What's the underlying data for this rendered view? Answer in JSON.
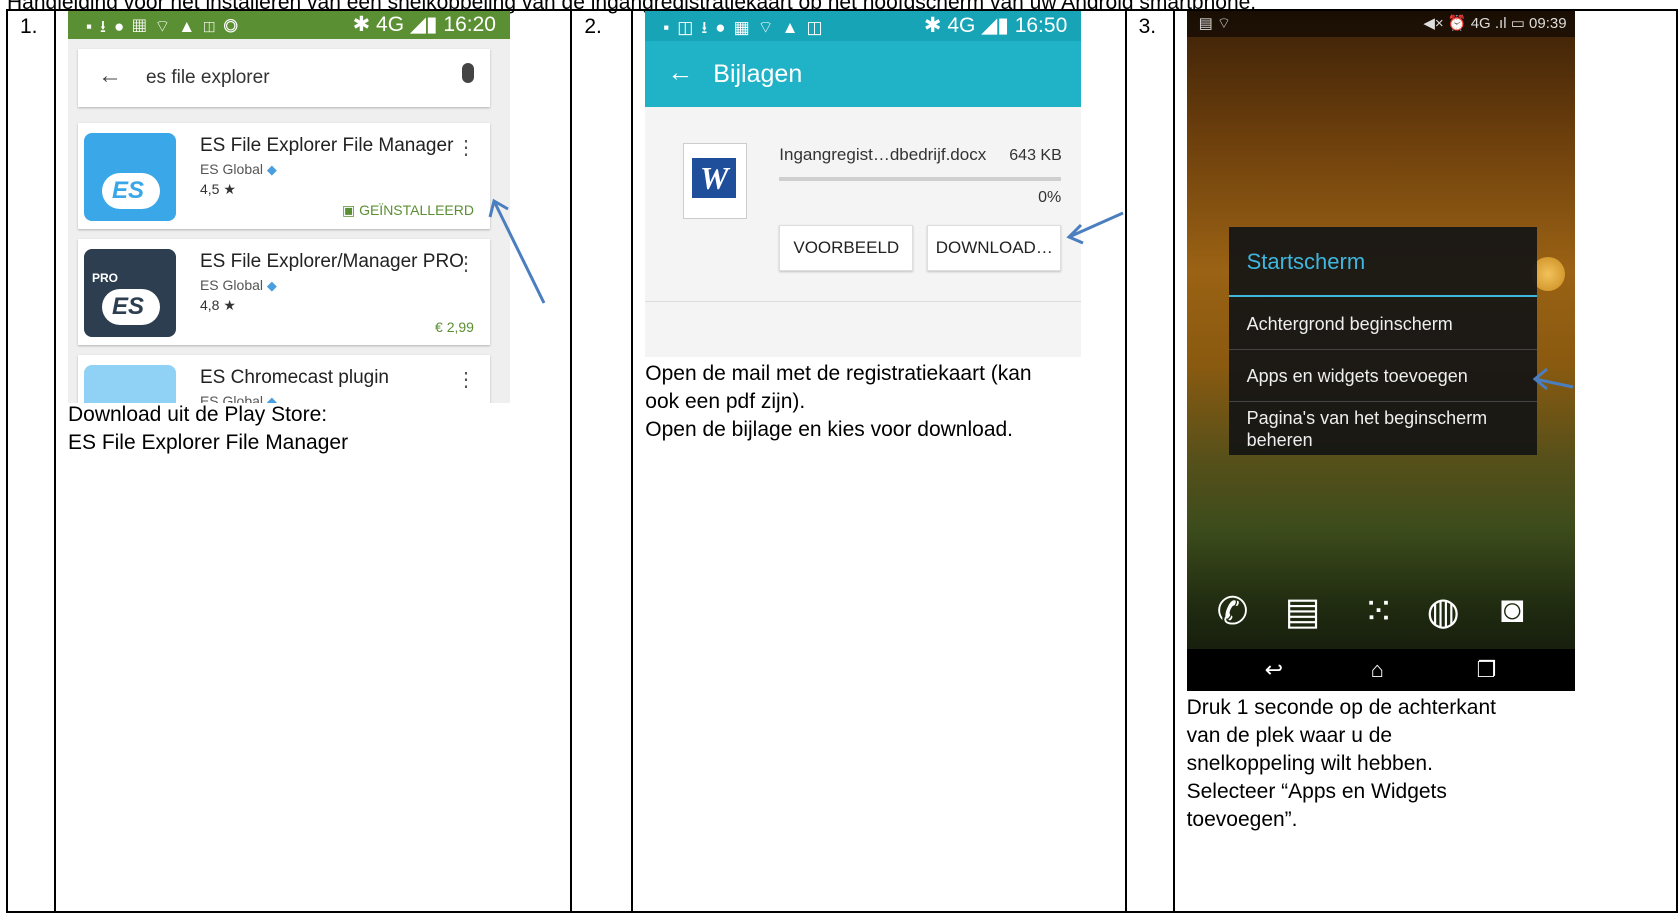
{
  "document": {
    "title": "Handleiding voor het installeren van een snelkoppeling van de ingangregistratiekaart op het hoofdscherm van uw Android smartphone:"
  },
  "steps": [
    {
      "number": "1.",
      "screenshot": {
        "status_time": "16:20",
        "network": "4G",
        "search_query": "es file explorer",
        "apps": [
          {
            "name": "ES File Explorer File Manager",
            "developer": "ES Global",
            "rating": "4,5",
            "status": "GEÏNSTALLEERD"
          },
          {
            "name": "ES File Explorer/Manager PRO",
            "developer": "ES Global",
            "rating": "4,8",
            "status": "€ 2,99",
            "badge": "PRO"
          },
          {
            "name": "ES Chromecast plugin",
            "developer": "ES Global"
          }
        ]
      },
      "caption_line1": "Download uit de Play Store:",
      "caption_line2": "ES File Explorer File Manager"
    },
    {
      "number": "2.",
      "screenshot": {
        "status_time": "16:50",
        "network": "4G",
        "title": "Bijlagen",
        "file_name": "Ingangregist…dbedrijf.docx",
        "file_size": "643 KB",
        "progress_percent": "0%",
        "progress_value": 0,
        "btn_preview": "VOORBEELD",
        "btn_download": "DOWNLOAD…"
      },
      "caption_line1": "Open de mail met de registratiekaart (kan",
      "caption_line2": "ook een pdf zijn).",
      "caption_line3": "Open de bijlage en kies voor download."
    },
    {
      "number": "3.",
      "screenshot": {
        "status_time": "09:39",
        "network": "4G",
        "menu_title": "Startscherm",
        "menu_items": [
          "Achtergrond beginscherm",
          "Apps en widgets toevoegen",
          "Pagina's van het beginscherm beheren"
        ]
      },
      "caption_line1": "Druk 1 seconde op de achterkant",
      "caption_line2": "van de plek waar u de",
      "caption_line3": "snelkoppeling wilt hebben.",
      "caption_line4": "Selecteer “Apps en Widgets",
      "caption_line5": "toevoegen”."
    }
  ],
  "colors": {
    "arrow": "#4a7ebf",
    "playstore_green": "#5b8f33",
    "mail_teal": "#20b3c7",
    "holo_blue": "#3fb6e0"
  }
}
